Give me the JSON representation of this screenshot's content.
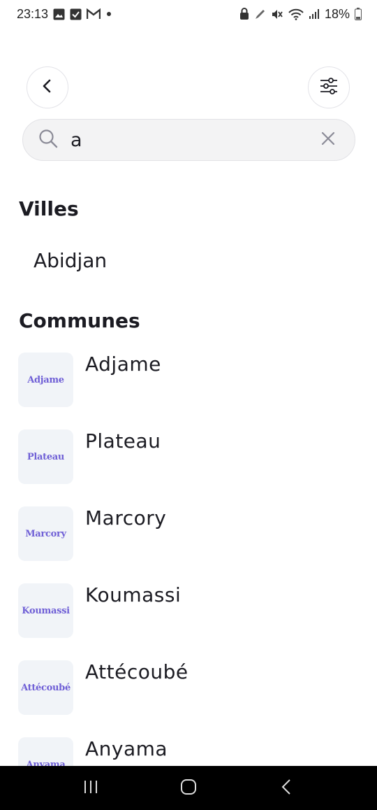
{
  "status_bar": {
    "time": "23:13",
    "battery": "18%",
    "left_icons": [
      "gallery-icon",
      "checkbox-icon",
      "gmail-icon",
      "dot-icon"
    ],
    "right_icons": [
      "lock-icon",
      "pen-icon",
      "mute-icon",
      "wifi-icon",
      "signal-icon",
      "battery-icon"
    ]
  },
  "header": {
    "back_icon": "chevron-left-icon",
    "filter_icon": "sliders-icon"
  },
  "search": {
    "value": "a",
    "search_icon": "search-icon",
    "clear_icon": "close-icon"
  },
  "villes": {
    "title": "Villes",
    "items": [
      {
        "label": "Abidjan"
      }
    ]
  },
  "communes": {
    "title": "Communes",
    "items": [
      {
        "label": "Adjame",
        "thumb_text": "Adjame"
      },
      {
        "label": "Plateau",
        "thumb_text": "Plateau"
      },
      {
        "label": "Marcory",
        "thumb_text": "Marcory"
      },
      {
        "label": "Koumassi",
        "thumb_text": "Koumassi"
      },
      {
        "label": "Attécoubé",
        "thumb_text": "Attécoubé"
      },
      {
        "label": "Anyama",
        "thumb_text": "Anyama"
      }
    ]
  },
  "colors": {
    "accent_thumb_text": "#6f5fd6",
    "thumb_bg": "#f1f4f8",
    "search_bg": "#f3f3f4",
    "nav_bar": "#000000"
  },
  "nav_bar": {
    "icons": [
      "recent-apps-icon",
      "home-icon",
      "back-icon"
    ]
  }
}
